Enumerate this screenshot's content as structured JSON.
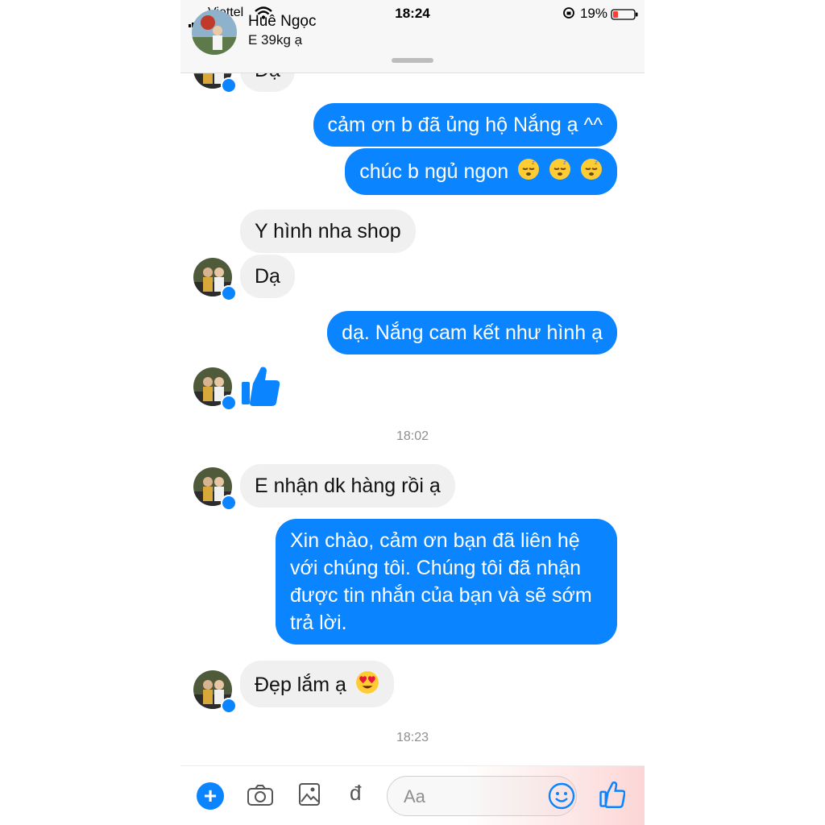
{
  "status_bar": {
    "carrier": "Viettel",
    "time": "18:24",
    "battery": "19%"
  },
  "header": {
    "name": "Huê Ngọc",
    "subtitle": "E 39kg ạ"
  },
  "messages": {
    "partial_in": "Dạ",
    "out_1": "cảm ơn b đã ủng hộ Nắng ạ ^^",
    "out_2": "chúc b ngủ ngon",
    "in_1": "Y hình nha shop",
    "in_2": "Dạ",
    "out_3": "dạ. Nắng cam kết như hình ạ",
    "ts_1": "18:02",
    "in_3": "E nhận dk hàng rồi ạ",
    "out_4": "Xin chào, cảm ơn bạn đã liên hệ với chúng tôi. Chúng tôi đã nhận được tin nhắn của bạn và sẽ sớm trả lời.",
    "in_4": "Đẹp lắm ạ",
    "ts_2": "18:23"
  },
  "composer": {
    "placeholder": "Aa",
    "currency_symbol": "đ"
  },
  "colors": {
    "accent": "#0a84ff",
    "incoming_bubble": "#f0f0f0"
  },
  "icons": [
    "plus-icon",
    "camera-icon",
    "image-icon",
    "dong-icon",
    "smile-icon",
    "thumbs-up-icon",
    "sleepy-emoji",
    "heart-eyes-emoji",
    "messenger-badge-icon"
  ]
}
